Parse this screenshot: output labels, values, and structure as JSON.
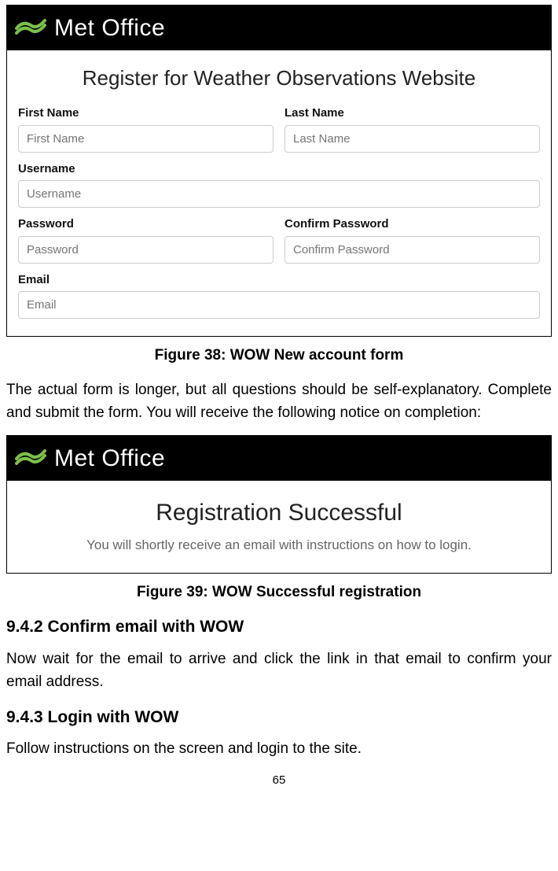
{
  "figure1": {
    "brand": "Met Office",
    "title": "Register for Weather Observations Website",
    "fields": {
      "first_name": {
        "label": "First Name",
        "placeholder": "First Name"
      },
      "last_name": {
        "label": "Last Name",
        "placeholder": "Last Name"
      },
      "username": {
        "label": "Username",
        "placeholder": "Username"
      },
      "password": {
        "label": "Password",
        "placeholder": "Password"
      },
      "confirm_password": {
        "label": "Confirm Password",
        "placeholder": "Confirm Password"
      },
      "email": {
        "label": "Email",
        "placeholder": "Email"
      }
    },
    "caption": "Figure 38: WOW New account form"
  },
  "para1": "The actual form is longer, but all questions should be self-explanatory. Complete and submit the form. You will receive the following notice on completion:",
  "figure2": {
    "brand": "Met Office",
    "title": "Registration Successful",
    "subtitle": "You will shortly receive an email with instructions on how to login.",
    "caption": "Figure 39: WOW Successful registration"
  },
  "section942": {
    "heading": "9.4.2 Confirm email with WOW",
    "body": "Now wait for the email to arrive and click the link in that email to confirm your email address."
  },
  "section943": {
    "heading": "9.4.3 Login with WOW",
    "body": "Follow instructions on the screen and login to the site."
  },
  "page_number": "65"
}
